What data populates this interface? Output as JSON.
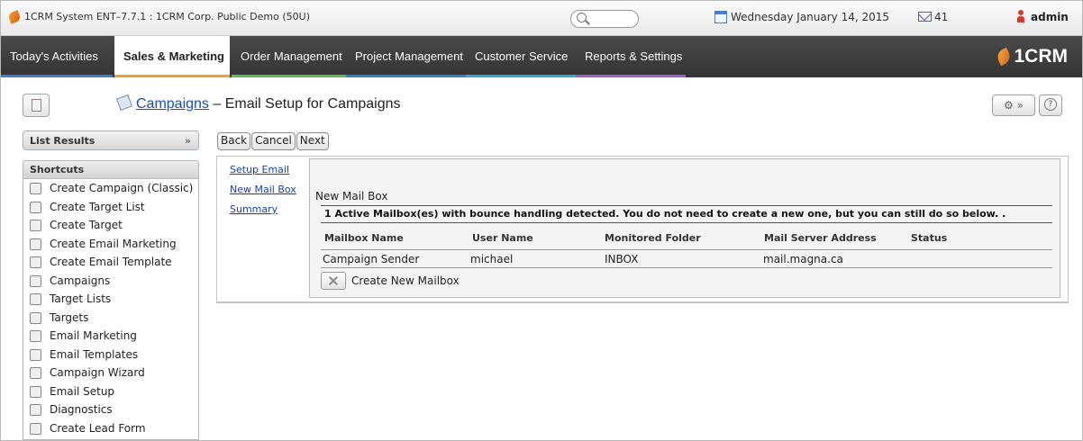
{
  "topbar": {
    "app_title": "1CRM System ENT–7.7.1 : 1CRM Corp. Public Demo (50U)",
    "date": "Wednesday January 14, 2015",
    "mail_count": "41",
    "user": "admin"
  },
  "nav": {
    "items": [
      "Today's Activities",
      "Sales & Marketing",
      "Order Management",
      "Project Management",
      "Customer Service",
      "Reports & Settings"
    ],
    "active": "Sales & Marketing",
    "bar_colors": [
      "#3d7bd6",
      "#f0a32f",
      "#5cb85c",
      "#2f7fd4",
      "#2fa9d4",
      "#9b5cc7"
    ],
    "brand": "1CRM"
  },
  "header": {
    "module_link": "Campaigns",
    "title_suffix": " – Email Setup for Campaigns"
  },
  "sidebar": {
    "list_results": "List Results",
    "shortcuts_title": "Shortcuts",
    "items": [
      "Create Campaign (Classic)",
      "Create Target List",
      "Create Target",
      "Create Email Marketing",
      "Create Email Template",
      "Campaigns",
      "Target Lists",
      "Targets",
      "Email Marketing",
      "Email Templates",
      "Campaign Wizard",
      "Email Setup",
      "Diagnostics",
      "Create Lead Form"
    ]
  },
  "wizard": {
    "buttons": {
      "back": "Back",
      "cancel": "Cancel",
      "next": "Next"
    },
    "steps": [
      "Setup Email",
      "New Mail Box",
      "Summary"
    ],
    "section_title": "New Mail Box",
    "notice": "1 Active Mailbox(es) with bounce handling detected. You do not need to create a new one, but you can still do so below. .",
    "columns": [
      "Mailbox Name",
      "User Name",
      "Monitored Folder",
      "Mail Server Address",
      "Status"
    ],
    "rows": [
      {
        "mailbox": "Campaign Sender",
        "user": "michael",
        "folder": "INBOX",
        "server": "mail.magna.ca",
        "status": ""
      }
    ],
    "create_label": "Create New Mailbox"
  }
}
